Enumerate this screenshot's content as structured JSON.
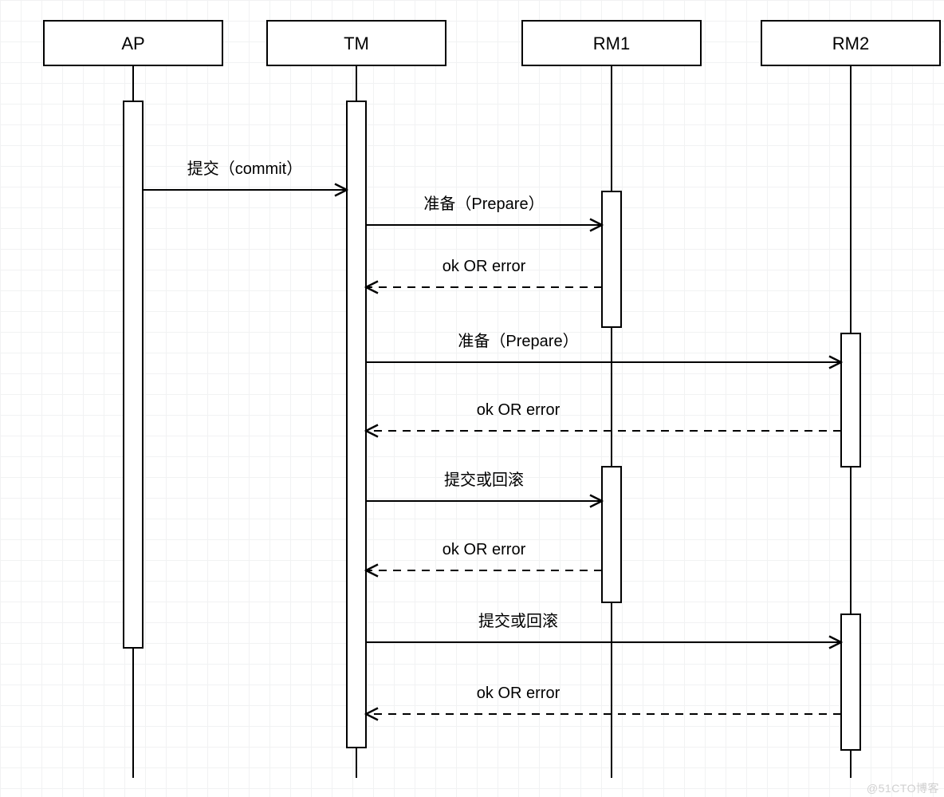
{
  "diagram": {
    "type": "sequence",
    "participants": {
      "ap": {
        "label": "AP"
      },
      "tm": {
        "label": "TM"
      },
      "rm1": {
        "label": "RM1"
      },
      "rm2": {
        "label": "RM2"
      }
    },
    "messages": {
      "m1": "提交（commit）",
      "m2": "准备（Prepare）",
      "m3": "ok OR error",
      "m4": "准备（Prepare）",
      "m5": "ok OR error",
      "m6": "提交或回滚",
      "m7": "ok OR error",
      "m8": "提交或回滚",
      "m9": "ok OR error"
    },
    "watermark": "@51CTO博客"
  }
}
